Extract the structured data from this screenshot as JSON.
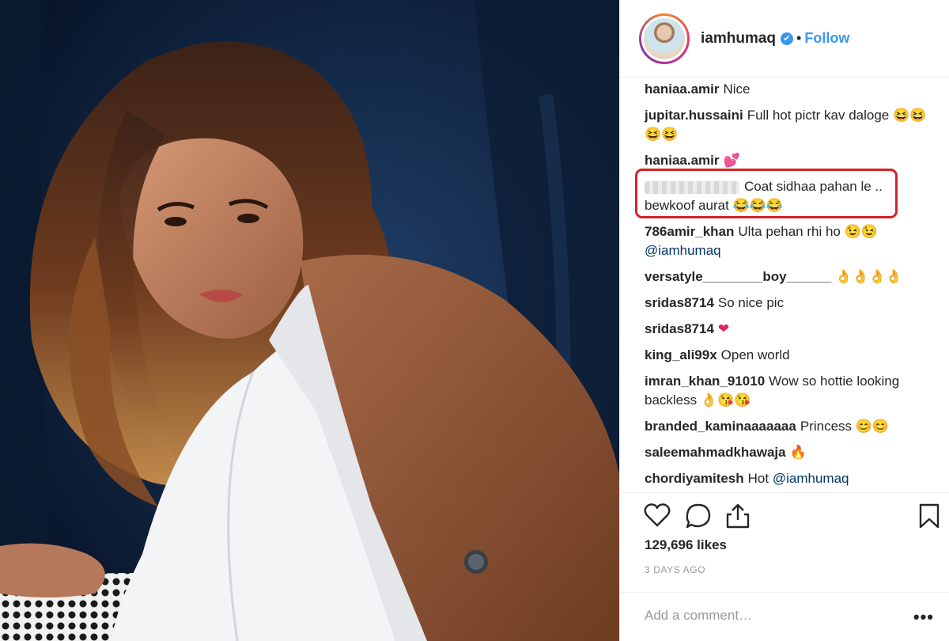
{
  "post": {
    "username": "iamhumaq",
    "verified_mark": "✔",
    "separator": "•",
    "follow_label": "Follow",
    "likes": "129,696 likes",
    "time_ago": "3 DAYS AGO",
    "add_comment_placeholder": "Add a comment…",
    "more_label": "•••"
  },
  "comments": [
    {
      "user": "haniaa.amir",
      "text": "Nice",
      "emoji": ""
    },
    {
      "user": "jupitar.hussaini",
      "text": "Full hot pictr kav daloge",
      "emoji": "😆😆😆😆"
    },
    {
      "user": "haniaa.amir",
      "text": "",
      "emoji": "💕"
    },
    {
      "user": "",
      "text": "Coat sidhaa pahan le .. bewkoof aurat",
      "emoji": "😂😂😂",
      "blurred_user": true,
      "highlighted": true
    },
    {
      "user": "786amir_khan",
      "text": "Ulta pehan rhi ho",
      "emoji": "😉😉",
      "mention": "@iamhumaq"
    },
    {
      "user": "versatyle________boy______",
      "text": "",
      "emoji": "👌👌👌👌"
    },
    {
      "user": "sridas8714",
      "text": "So nice pic",
      "emoji": ""
    },
    {
      "user": "sridas8714",
      "text": "",
      "emoji": "❤"
    },
    {
      "user": "king_ali99x",
      "text": "Open world",
      "emoji": ""
    },
    {
      "user": "imran_khan_91010",
      "text": "Wow so hottie looking backless",
      "emoji": "👌😘😘"
    },
    {
      "user": "branded_kaminaaaaaaa",
      "text": "Princess",
      "emoji": "😊😊"
    },
    {
      "user": "saleemahmadkhawaja",
      "text": "",
      "emoji": "🔥"
    },
    {
      "user": "chordiyamitesh",
      "text": "Hot",
      "emoji": "",
      "mention": "@iamhumaq"
    }
  ],
  "icons": {
    "like": "heart-outline-icon",
    "comment": "speech-bubble-icon",
    "share": "share-upload-icon",
    "save": "bookmark-icon"
  },
  "colors": {
    "accent": "#3897f0",
    "highlight": "#d2232a",
    "text": "#262626",
    "muted": "#999999",
    "mention": "#003569"
  }
}
